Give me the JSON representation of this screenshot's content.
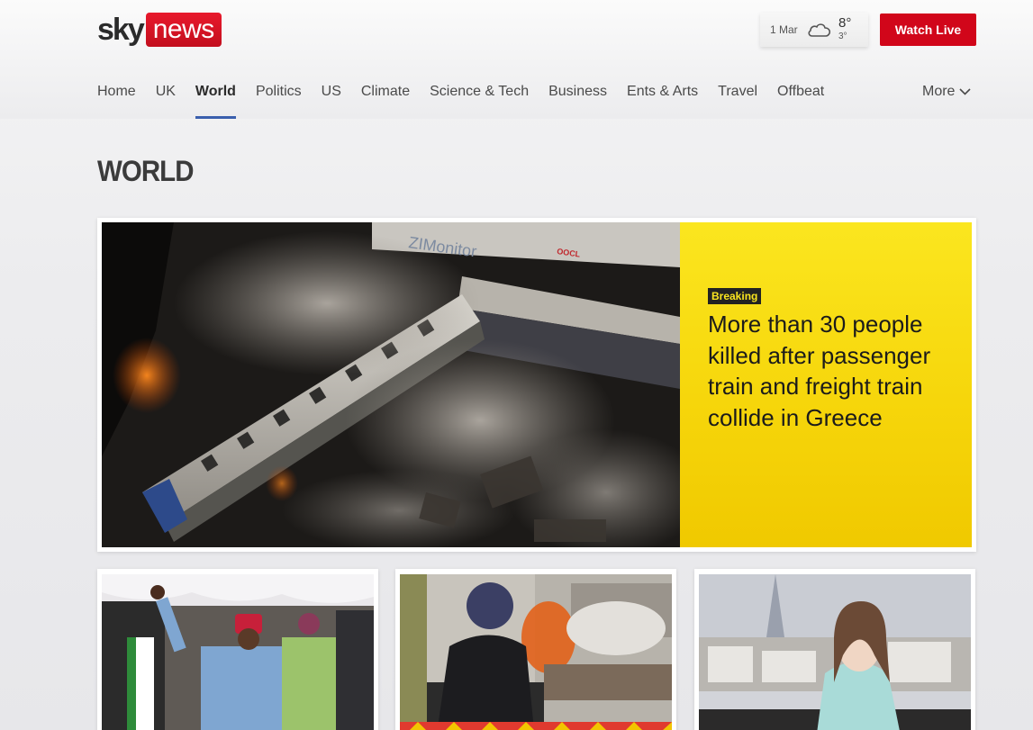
{
  "brand": {
    "sky": "sky",
    "news": "news",
    "news_color": "#d7101f"
  },
  "weather": {
    "date": "1 Mar",
    "icon": "cloud-icon",
    "high": "8°",
    "low": "3°"
  },
  "header": {
    "watch_live": "Watch Live",
    "watch_live_color": "#d1061a"
  },
  "nav": {
    "items": [
      {
        "label": "Home"
      },
      {
        "label": "UK"
      },
      {
        "label": "World",
        "active": true
      },
      {
        "label": "Politics"
      },
      {
        "label": "US"
      },
      {
        "label": "Climate"
      },
      {
        "label": "Science & Tech"
      },
      {
        "label": "Business"
      },
      {
        "label": "Ents & Arts"
      },
      {
        "label": "Travel"
      },
      {
        "label": "Offbeat"
      }
    ],
    "more": "More",
    "active_underline_color": "#3a5fad"
  },
  "page": {
    "title": "WORLD"
  },
  "hero": {
    "badge": "Breaking",
    "headline": "More than 30 people killed after passenger train and freight train collide in Greece",
    "image_text_1": "ZIMonitor",
    "image_text_2": "OOCL",
    "panel_color": "#f8dc10"
  },
  "cards": [
    {
      "image": "rally-photo"
    },
    {
      "image": "fire-window-photo"
    },
    {
      "image": "paris-portrait-photo"
    }
  ]
}
